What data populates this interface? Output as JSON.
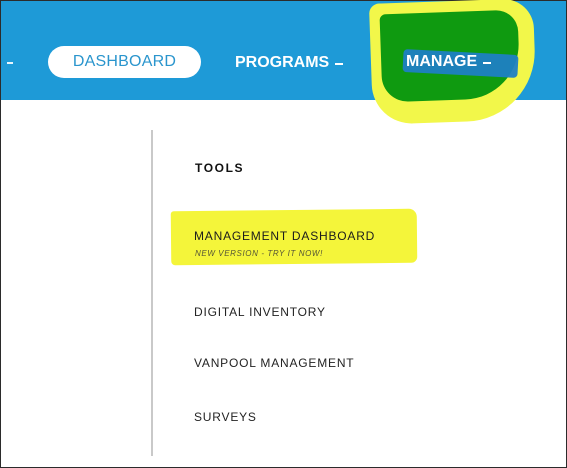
{
  "nav": {
    "dashboard_label": "DASHBOARD",
    "programs_label": "PROGRAMS",
    "manage_label": "MANAGE"
  },
  "dropdown": {
    "section_heading": "TOOLS",
    "items": [
      {
        "label": "MANAGEMENT DASHBOARD",
        "sublabel": "NEW VERSION - TRY IT NOW!"
      },
      {
        "label": "DIGITAL INVENTORY"
      },
      {
        "label": "VANPOOL MANAGEMENT"
      },
      {
        "label": "SURVEYS"
      }
    ]
  },
  "colors": {
    "nav_blue": "#1e9ad7",
    "dashboard_text": "#2a95cd",
    "highlight_yellow": "#f4f53a",
    "marker_green": "#0f9a10"
  },
  "icons": [
    "chevron-down-icon"
  ]
}
